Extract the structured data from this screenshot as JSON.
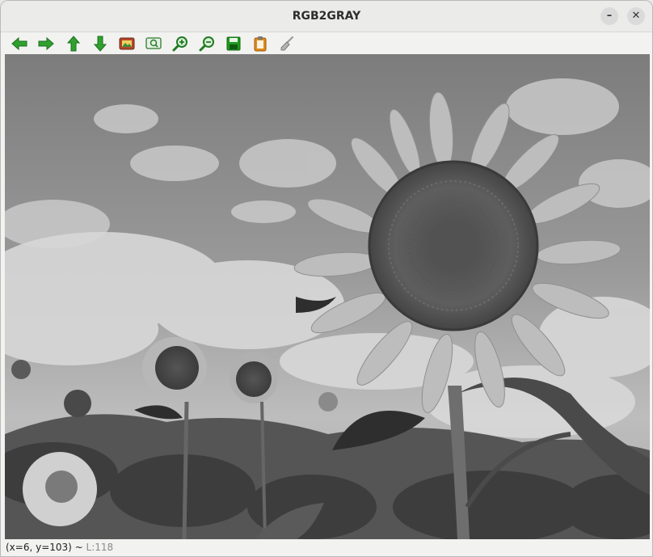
{
  "window": {
    "title": "RGB2GRAY",
    "minimize_glyph": "–",
    "close_glyph": "✕"
  },
  "toolbar": {
    "buttons": [
      {
        "name": "pan-left",
        "icon": "arrow-left-icon"
      },
      {
        "name": "pan-right",
        "icon": "arrow-right-icon"
      },
      {
        "name": "pan-up",
        "icon": "arrow-up-icon"
      },
      {
        "name": "pan-down",
        "icon": "arrow-down-icon"
      },
      {
        "name": "shrink-to-window",
        "icon": "picture-icon"
      },
      {
        "name": "zoom-image",
        "icon": "zoom-fit-icon"
      },
      {
        "name": "zoom-in",
        "icon": "zoom-in-icon"
      },
      {
        "name": "zoom-out",
        "icon": "zoom-out-icon"
      },
      {
        "name": "save",
        "icon": "floppy-disk-icon"
      },
      {
        "name": "copy-to-clipboard",
        "icon": "clipboard-icon"
      },
      {
        "name": "properties",
        "icon": "brush-icon"
      }
    ],
    "colors": {
      "arrow": "#2fa12f",
      "save": "#1e9a1e",
      "clipboard": "#e08a18"
    }
  },
  "image": {
    "content": "grayscale photograph of sunflowers against a cloudy sky"
  },
  "status": {
    "coords": "(x=6, y=103) ~",
    "level": "L:118"
  }
}
